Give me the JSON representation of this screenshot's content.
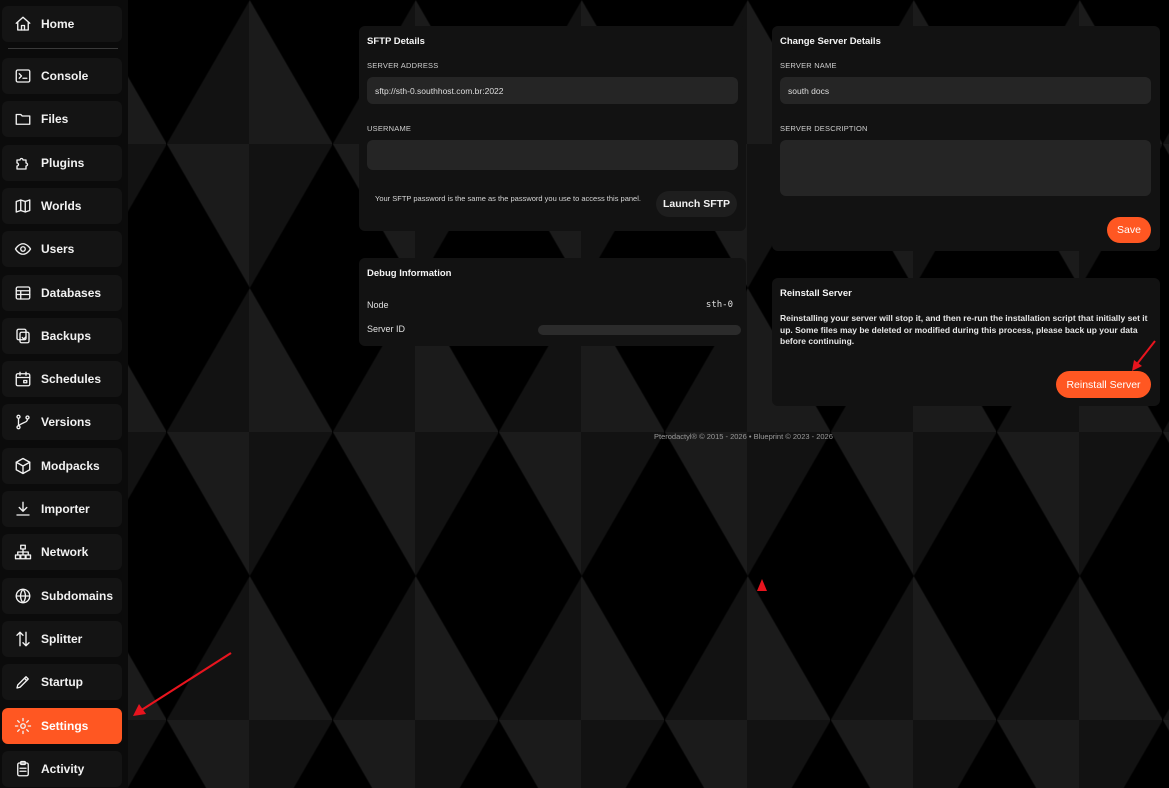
{
  "sidebar": {
    "items": [
      {
        "label": "Home",
        "icon": "home-icon"
      },
      {
        "label": "Console",
        "icon": "terminal-icon"
      },
      {
        "label": "Files",
        "icon": "folder-icon"
      },
      {
        "label": "Plugins",
        "icon": "puzzle-icon"
      },
      {
        "label": "Worlds",
        "icon": "map-icon"
      },
      {
        "label": "Users",
        "icon": "eye-icon"
      },
      {
        "label": "Databases",
        "icon": "table-icon"
      },
      {
        "label": "Backups",
        "icon": "backup-icon"
      },
      {
        "label": "Schedules",
        "icon": "calendar-icon"
      },
      {
        "label": "Versions",
        "icon": "git-branch-icon"
      },
      {
        "label": "Modpacks",
        "icon": "package-icon"
      },
      {
        "label": "Importer",
        "icon": "download-icon"
      },
      {
        "label": "Network",
        "icon": "sitemap-icon"
      },
      {
        "label": "Subdomains",
        "icon": "globe-icon"
      },
      {
        "label": "Splitter",
        "icon": "split-arrows-icon"
      },
      {
        "label": "Startup",
        "icon": "pencil-icon"
      },
      {
        "label": "Settings",
        "icon": "gear-icon"
      },
      {
        "label": "Activity",
        "icon": "clipboard-icon"
      }
    ],
    "active": "Settings"
  },
  "sftp": {
    "title": "SFTP Details",
    "address_label": "SERVER ADDRESS",
    "address_value": "sftp://sth-0.southhost.com.br:2022",
    "username_label": "USERNAME",
    "username_value": "",
    "note": "Your SFTP password is the same as the password you use to access this panel.",
    "launch_label": "Launch SFTP"
  },
  "debug": {
    "title": "Debug Information",
    "node_label": "Node",
    "node_value": "sth-0",
    "server_id_label": "Server ID",
    "server_id_value": ""
  },
  "server_details": {
    "title": "Change Server Details",
    "name_label": "SERVER NAME",
    "name_value": "south docs",
    "description_label": "SERVER DESCRIPTION",
    "description_value": "",
    "save_label": "Save"
  },
  "reinstall": {
    "title": "Reinstall Server",
    "warning": "Reinstalling your server will stop it, and then re-run the installation script that initially set it up. Some files may be deleted or modified during this process, please back up your data before continuing.",
    "button_label": "Reinstall Server"
  },
  "footer": {
    "text": "Pterodactyl® © 2015 - 2026  •  Blueprint © 2023 - 2026"
  },
  "colors": {
    "accent": "#ff5722",
    "annotation_arrow": "#e8141e"
  }
}
